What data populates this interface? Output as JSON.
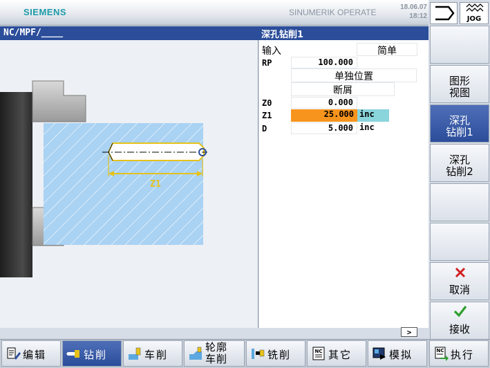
{
  "header": {
    "logo": "SIEMENS",
    "product": "SINUMERIK OPERATE",
    "date": "18.06.07",
    "time": "18:12",
    "mode_label": "JOG"
  },
  "titlebar": {
    "path": "NC/MPF/____",
    "cycle_title": "深孔钻削1"
  },
  "graphic": {
    "dimension_label": "Z1",
    "colors": {
      "workpiece": "#a9d2f3",
      "hatch": "#ffffff",
      "chuck": "#3b3b3b",
      "drill_outline": "#e6c21a"
    }
  },
  "params": {
    "rows": [
      {
        "label": "输入",
        "value": "简单",
        "unit": ""
      },
      {
        "label": "RP",
        "value": "100.000",
        "unit": ""
      },
      {
        "label": "",
        "value": "单独位置",
        "unit": ""
      },
      {
        "label": "",
        "value": "断屑",
        "unit": ""
      },
      {
        "label": "Z0",
        "value": "0.000",
        "unit": ""
      },
      {
        "label": "Z1",
        "value": "25.000",
        "unit": "inc"
      },
      {
        "label": "D",
        "value": "5.000",
        "unit": "inc"
      }
    ],
    "colors": {
      "highlight": "#f7941d",
      "unit_highlight": "#8ad4dc"
    }
  },
  "scroll_indicator": ">",
  "right_softkeys": [
    {
      "label": ""
    },
    {
      "label": "图形\n视图"
    },
    {
      "label": "深孔\n钻削1"
    },
    {
      "label": "深孔\n钻削2"
    },
    {
      "label": ""
    },
    {
      "label": ""
    },
    {
      "label": "取消",
      "icon": "cancel-x-icon"
    },
    {
      "label": "接收",
      "icon": "accept-check-icon"
    }
  ],
  "bottom_softkeys": [
    {
      "label": "编辑",
      "icon": "edit-icon"
    },
    {
      "label": "钻削",
      "icon": "drilling-icon"
    },
    {
      "label": "车削",
      "icon": "turning-icon"
    },
    {
      "label": "轮廓\n车削",
      "icon": "contour-turning-icon"
    },
    {
      "label": "铣削",
      "icon": "milling-icon"
    },
    {
      "label": "其它",
      "icon": "nc-misc-icon"
    },
    {
      "label": "模拟",
      "icon": "simulation-icon"
    },
    {
      "label": "执行",
      "icon": "nc-execute-icon"
    }
  ]
}
